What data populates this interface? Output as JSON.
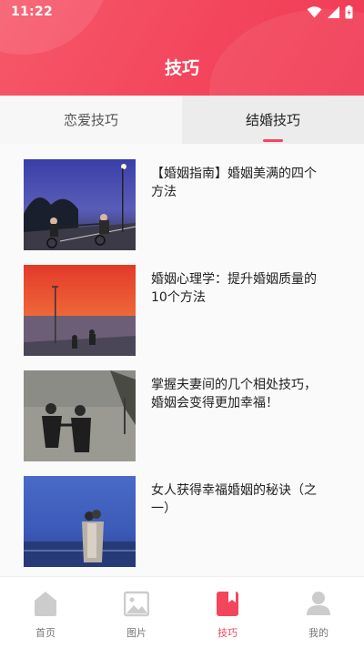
{
  "status_bar": {
    "time": "11:22"
  },
  "header": {
    "title": "技巧"
  },
  "tabs": [
    {
      "label": "恋爱技巧",
      "active": false
    },
    {
      "label": "结婚技巧",
      "active": true
    }
  ],
  "articles": [
    {
      "title": "【婚姻指南】婚姻美满的四个方法"
    },
    {
      "title": "婚姻心理学：提升婚姻质量的10个方法"
    },
    {
      "title": "掌握夫妻间的几个相处技巧，婚姻会变得更加幸福！"
    },
    {
      "title": "女人获得幸福婚姻的秘诀（之一）"
    }
  ],
  "tabbar": {
    "items": [
      {
        "label": "首页",
        "icon": "home-icon",
        "active": false
      },
      {
        "label": "图片",
        "icon": "image-icon",
        "active": false
      },
      {
        "label": "技巧",
        "icon": "book-icon",
        "active": true
      },
      {
        "label": "我的",
        "icon": "user-icon",
        "active": false
      }
    ]
  },
  "colors": {
    "accent": "#f3465c",
    "inactive_icon": "#cccccc"
  }
}
